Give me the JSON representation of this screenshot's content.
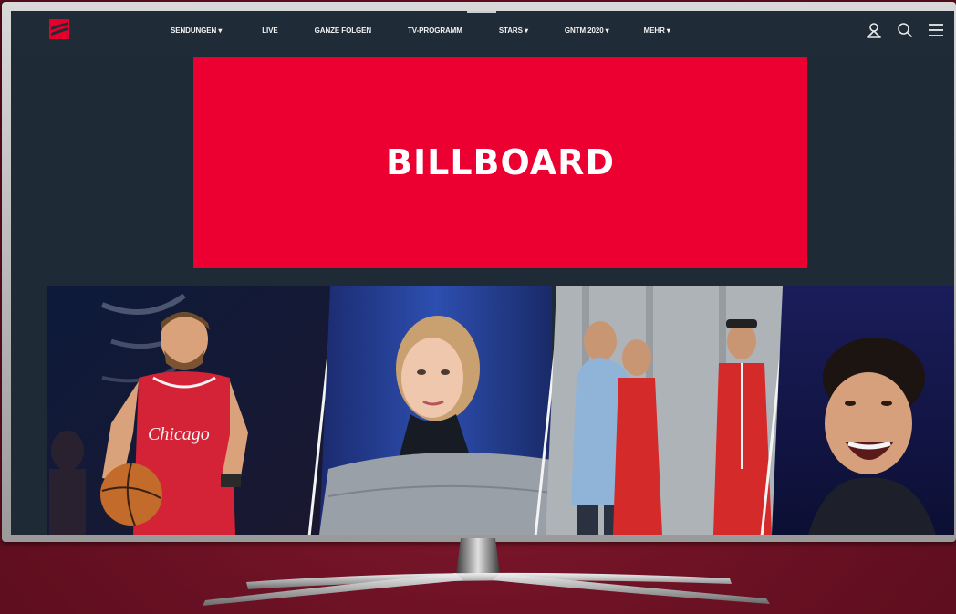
{
  "header": {
    "logo_icon": "prosieben-logo",
    "nav_items": [
      {
        "label": "SENDUNGEN ▾"
      },
      {
        "label": "LIVE"
      },
      {
        "label": "GANZE FOLGEN"
      },
      {
        "label": "TV-PROGRAMM"
      },
      {
        "label": "STARS ▾"
      },
      {
        "label": "GNTM 2020 ▾"
      },
      {
        "label": "MEHR ▾"
      }
    ],
    "actions": [
      "user-icon",
      "search-icon",
      "menu-icon"
    ]
  },
  "billboard": {
    "label": "BILLBOARD",
    "color": "#ec0032"
  },
  "tiles": [
    {
      "name": "tile-klaas-basketball",
      "jersey_text": "Chicago"
    },
    {
      "name": "tile-blonde-woman-stage"
    },
    {
      "name": "tile-race-suits-group"
    },
    {
      "name": "tile-laughing-man"
    }
  ],
  "colors": {
    "background": "#6b1124",
    "navbar": "#1f2b37",
    "screen": "#1e2a36",
    "accent": "#ec0032"
  }
}
